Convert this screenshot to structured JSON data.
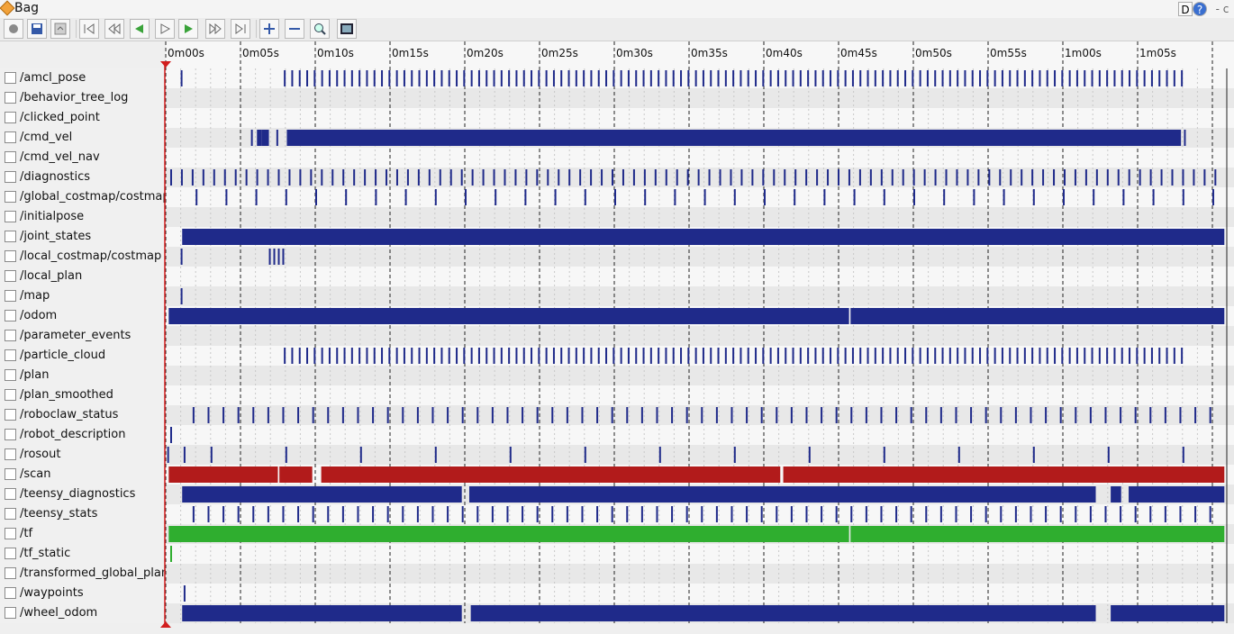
{
  "window": {
    "title": "Bag",
    "right_buttons": [
      "D",
      "?",
      "- c"
    ]
  },
  "toolbar": {
    "buttons": [
      "record",
      "save",
      "load",
      "go-start",
      "skip-back",
      "play-back",
      "pause",
      "play",
      "skip-forward",
      "go-end",
      "zoom-in",
      "zoom-out",
      "zoom-fit",
      "thumbnails"
    ]
  },
  "timeline": {
    "tick_labels": [
      "0m00s",
      "0m05s",
      "0m10s",
      "0m15s",
      "0m20s",
      "0m25s",
      "0m30s",
      "0m35s",
      "0m40s",
      "0m45s",
      "0m50s",
      "0m55s",
      "1m00s",
      "1m05s"
    ],
    "duration_s": 70.5,
    "marker_color": "#d21e1e"
  },
  "colors": {
    "navy": "#1f2a8a",
    "red": "#b21b1b",
    "green": "#2fae2f"
  },
  "topics": [
    {
      "name": "/amcl_pose",
      "color": "navy",
      "messages": "periodic 0.5s from 8s to 68s"
    },
    {
      "name": "/behavior_tree_log",
      "color": "navy",
      "messages": "none"
    },
    {
      "name": "/clicked_point",
      "color": "navy",
      "messages": "none"
    },
    {
      "name": "/cmd_vel",
      "color": "navy",
      "messages": "continuous 8s to 68.5s"
    },
    {
      "name": "/cmd_vel_nav",
      "color": "navy",
      "messages": "none"
    },
    {
      "name": "/diagnostics",
      "color": "navy",
      "messages": "periodic 0.7s"
    },
    {
      "name": "/global_costmap/costmap",
      "color": "navy",
      "messages": "periodic 2s"
    },
    {
      "name": "/initialpose",
      "color": "navy",
      "messages": "none"
    },
    {
      "name": "/joint_states",
      "color": "navy",
      "messages": "continuous"
    },
    {
      "name": "/local_costmap/costmap",
      "color": "navy",
      "messages": "few"
    },
    {
      "name": "/local_plan",
      "color": "navy",
      "messages": "none"
    },
    {
      "name": "/map",
      "color": "navy",
      "messages": "single"
    },
    {
      "name": "/odom",
      "color": "navy",
      "messages": "continuous"
    },
    {
      "name": "/parameter_events",
      "color": "navy",
      "messages": "none"
    },
    {
      "name": "/particle_cloud",
      "color": "navy",
      "messages": "periodic 0.5s from 8s to 68s"
    },
    {
      "name": "/plan",
      "color": "navy",
      "messages": "none"
    },
    {
      "name": "/plan_smoothed",
      "color": "navy",
      "messages": "none"
    },
    {
      "name": "/roboclaw_status",
      "color": "navy",
      "messages": "periodic 1s"
    },
    {
      "name": "/robot_description",
      "color": "navy",
      "messages": "single"
    },
    {
      "name": "/rosout",
      "color": "navy",
      "messages": "periodic 5s"
    },
    {
      "name": "/scan",
      "color": "red",
      "messages": "continuous"
    },
    {
      "name": "/teensy_diagnostics",
      "color": "navy",
      "messages": "continuous with gaps"
    },
    {
      "name": "/teensy_stats",
      "color": "navy",
      "messages": "periodic 1s"
    },
    {
      "name": "/tf",
      "color": "green",
      "messages": "continuous"
    },
    {
      "name": "/tf_static",
      "color": "green",
      "messages": "single"
    },
    {
      "name": "/transformed_global_plan",
      "color": "navy",
      "messages": "none"
    },
    {
      "name": "/waypoints",
      "color": "navy",
      "messages": "single"
    },
    {
      "name": "/wheel_odom",
      "color": "navy",
      "messages": "continuous with gaps"
    }
  ]
}
